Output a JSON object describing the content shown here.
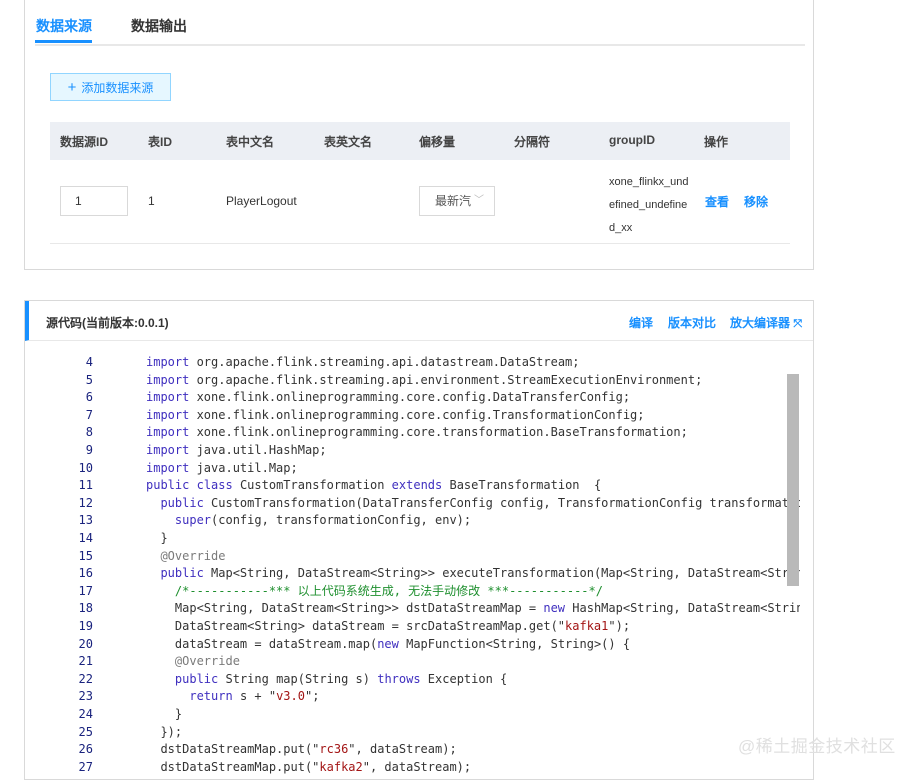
{
  "tabs": {
    "source": "数据来源",
    "output": "数据输出"
  },
  "add_button": {
    "icon": "plus-icon",
    "label": "添加数据来源"
  },
  "table": {
    "headers": [
      "数据源ID",
      "表ID",
      "表中文名",
      "表英文名",
      "偏移量",
      "分隔符",
      "groupID",
      "操作"
    ],
    "row": {
      "source_id": "1",
      "table_id": "1",
      "table_cn_name": "PlayerLogout",
      "table_en_name": "",
      "offset": "最新汽",
      "separator": "",
      "group_id": "xone_flinkx_undefined_undefined_xx",
      "view": "查看",
      "remove": "移除"
    }
  },
  "code_panel": {
    "title": "源代码(当前版本:0.0.1)",
    "compile": "编译",
    "diff": "版本对比",
    "expand": "放大编译器"
  },
  "code_lines": [
    {
      "n": "4",
      "t": "import org.apache.flink.streaming.api.datastream.DataStream;"
    },
    {
      "n": "5",
      "t": "import org.apache.flink.streaming.api.environment.StreamExecutionEnvironment;"
    },
    {
      "n": "6",
      "t": "import xone.flink.onlineprogramming.core.config.DataTransferConfig;"
    },
    {
      "n": "7",
      "t": "import xone.flink.onlineprogramming.core.config.TransformationConfig;"
    },
    {
      "n": "8",
      "t": "import xone.flink.onlineprogramming.core.transformation.BaseTransformation;"
    },
    {
      "n": "9",
      "t": "import java.util.HashMap;"
    },
    {
      "n": "10",
      "t": "import java.util.Map;"
    },
    {
      "n": "11",
      "t": "public class CustomTransformation extends BaseTransformation  {"
    },
    {
      "n": "12",
      "t": "  public CustomTransformation(DataTransferConfig config, TransformationConfig transformatio"
    },
    {
      "n": "13",
      "t": "    super(config, transformationConfig, env);"
    },
    {
      "n": "14",
      "t": "  }"
    },
    {
      "n": "15",
      "t": "  @Override"
    },
    {
      "n": "16",
      "t": "  public Map<String, DataStream<String>> executeTransformation(Map<String, DataStream<Strin"
    },
    {
      "n": "17",
      "t": "    /*-----------*** 以上代码系统生成, 无法手动修改 ***-----------*/"
    },
    {
      "n": "18",
      "t": "    Map<String, DataStream<String>> dstDataStreamMap = new HashMap<String, DataStream<Strin"
    },
    {
      "n": "19",
      "t": "    DataStream<String> dataStream = srcDataStreamMap.get(\"kafka1\");"
    },
    {
      "n": "20",
      "t": "    dataStream = dataStream.map(new MapFunction<String, String>() {"
    },
    {
      "n": "21",
      "t": "    @Override"
    },
    {
      "n": "22",
      "t": "    public String map(String s) throws Exception {"
    },
    {
      "n": "23",
      "t": "      return s + \"v3.0\";"
    },
    {
      "n": "24",
      "t": "    }"
    },
    {
      "n": "25",
      "t": "  });"
    },
    {
      "n": "26",
      "t": "  dstDataStreamMap.put(\"rc36\", dataStream);"
    },
    {
      "n": "27",
      "t": "  dstDataStreamMap.put(\"kafka2\", dataStream);"
    }
  ],
  "watermark": "@稀土掘金技术社区"
}
